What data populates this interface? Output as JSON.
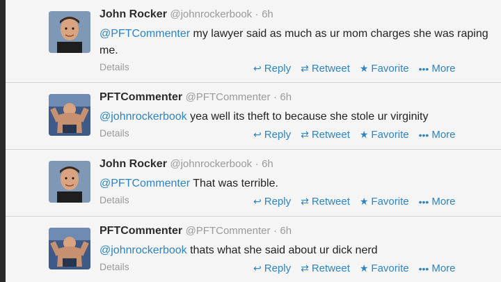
{
  "tweets": [
    {
      "name": "John Rocker",
      "handle": "@johnrockerbook",
      "time": "6h",
      "mention": "@PFTCommenter",
      "body": " my lawyer said as much as ur mom charges she was raping me.",
      "details": "Details",
      "avatar": "john-rocker-avatar"
    },
    {
      "name": "PFTCommenter",
      "handle": "@PFTCommenter",
      "time": "6h",
      "mention": "@johnrockerbook",
      "body": " yea well its theft to because she stole ur virginity",
      "details": "Details",
      "avatar": "pftcommenter-avatar"
    },
    {
      "name": "John Rocker",
      "handle": "@johnrockerbook",
      "time": "6h",
      "mention": "@PFTCommenter",
      "body": " That was terrible.",
      "details": "Details",
      "avatar": "john-rocker-avatar"
    },
    {
      "name": "PFTCommenter",
      "handle": "@PFTCommenter",
      "time": "6h",
      "mention": "@johnrockerbook",
      "body": " thats what she said about ur dick nerd",
      "details": "Details",
      "avatar": "pftcommenter-avatar"
    }
  ],
  "actions": {
    "reply": "Reply",
    "retweet": "Retweet",
    "favorite": "Favorite",
    "more": "More"
  },
  "separator": "·",
  "colors": {
    "link": "#2f83c0",
    "muted": "#9a9a9a",
    "background": "#f5f5f5"
  },
  "icons": {
    "reply": "reply-icon",
    "retweet": "retweet-icon",
    "favorite": "star-icon",
    "more": "more-dots-icon"
  }
}
